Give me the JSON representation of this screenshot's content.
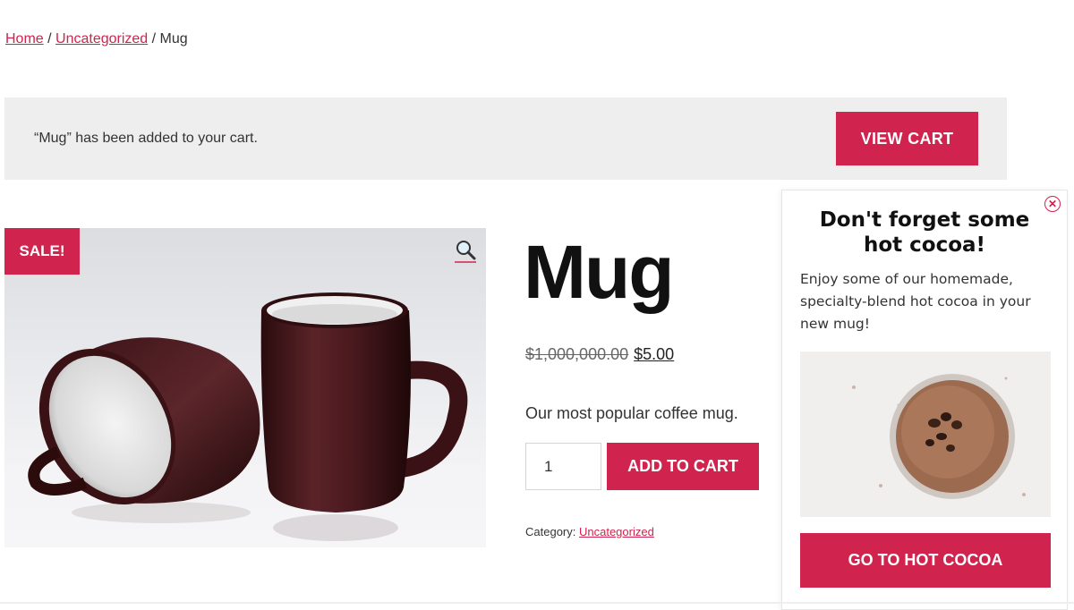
{
  "breadcrumb": {
    "home": "Home",
    "sep1": " / ",
    "category": "Uncategorized",
    "sep2": " / ",
    "current": "Mug"
  },
  "notice": {
    "message": "“Mug” has been added to your cart.",
    "button": "View cart"
  },
  "product": {
    "sale_badge": "SALE!",
    "zoom_icon": "magnifier-icon",
    "title": "Mug",
    "old_price": "$1,000,000.00",
    "new_price": "$5.00",
    "description": "Our most popular coffee mug.",
    "quantity": "1",
    "add_to_cart": "Add to cart",
    "category_label": "Category: ",
    "category_value": "Uncategorized"
  },
  "popup": {
    "close_icon": "close-icon",
    "title": "Don't forget some hot cocoa!",
    "body": "Enjoy some of our homemade, specialty-blend hot cocoa in your new mug!",
    "button": "Go to hot cocoa"
  },
  "colors": {
    "accent": "#d0234d",
    "notice_bg": "#eeeeee"
  }
}
